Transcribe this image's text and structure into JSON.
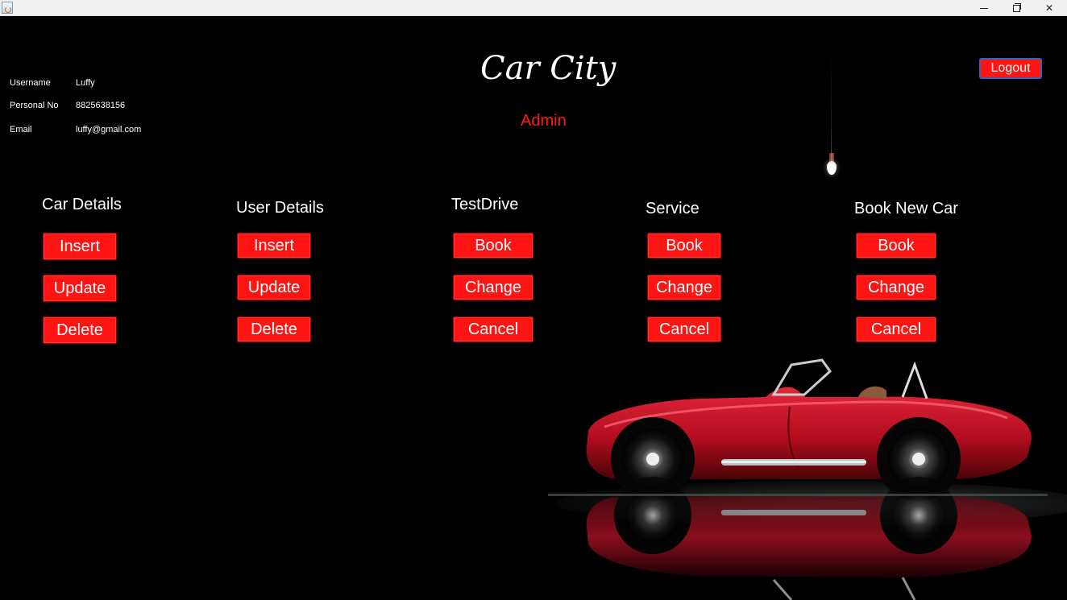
{
  "window": {
    "controls": {
      "minimize": "minimize",
      "maximize": "maximize",
      "close": "close"
    }
  },
  "user_info": {
    "username_label": "Username",
    "username_value": "Luffy",
    "personal_no_label": "Personal No",
    "personal_no_value": "8825638156",
    "email_label": "Email",
    "email_value": "luffy@gmail.com"
  },
  "header": {
    "title": "Car City",
    "role": "Admin",
    "logout_label": "Logout"
  },
  "sections": [
    {
      "title": "Car Details",
      "buttons": [
        "Insert",
        "Update",
        "Delete"
      ]
    },
    {
      "title": "User Details",
      "buttons": [
        "Insert",
        "Update",
        "Delete"
      ]
    },
    {
      "title": "TestDrive",
      "buttons": [
        "Book",
        "Change",
        "Cancel"
      ]
    },
    {
      "title": "Service",
      "buttons": [
        "Book",
        "Change",
        "Cancel"
      ]
    },
    {
      "title": "Book New Car",
      "buttons": [
        "Book",
        "Change",
        "Cancel"
      ]
    }
  ],
  "icons": {
    "app": "java-app-icon",
    "lamp": "hanging-bulb-icon",
    "car": "red-roadster-image"
  },
  "colors": {
    "background": "#000000",
    "accent": "#ff1414",
    "role_text": "#ff1a1a",
    "text": "#ffffff"
  }
}
